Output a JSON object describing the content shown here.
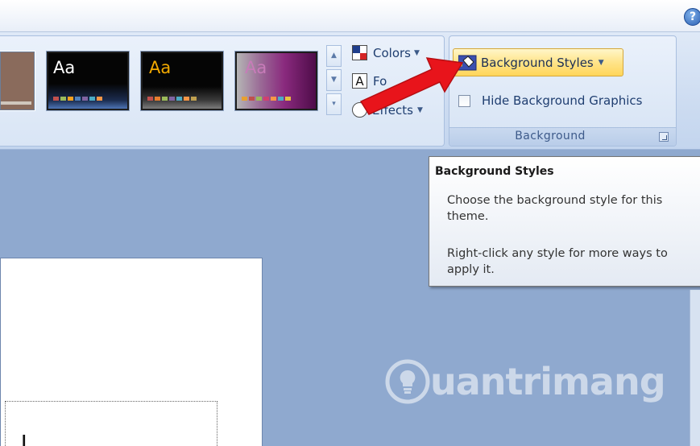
{
  "help": {
    "glyph": "?"
  },
  "themes": [
    {
      "aa": "",
      "aa_color": "#ffffff",
      "swatches": []
    },
    {
      "aa": "Aa",
      "aa_color": "#ffffff",
      "swatches": [
        "#c0504d",
        "#9bbb59",
        "#f4a020",
        "#4f81bd",
        "#8064a2",
        "#4bacc6",
        "#f79646"
      ]
    },
    {
      "aa": "Aa",
      "aa_color": "#f2a900",
      "swatches": [
        "#c0504d",
        "#e87d2e",
        "#9bbb59",
        "#8064a2",
        "#4bacc6",
        "#f79646",
        "#c0a050"
      ]
    },
    {
      "aa": "Aa",
      "aa_color": "#c87bb9",
      "swatches": [
        "#e8a030",
        "#c0504d",
        "#9bbb59",
        "#d04070",
        "#f79646",
        "#4bacc6",
        "#e8c040"
      ]
    }
  ],
  "theme_options": {
    "colors_label": "Colors",
    "fonts_label": "Fo",
    "effects_label": "Effects",
    "fonts_icon_glyph": "A"
  },
  "background_group": {
    "styles_button_label": "Background Styles",
    "hide_graphics_label": "Hide Background Graphics",
    "hide_graphics_checked": false,
    "group_label": "Background"
  },
  "tooltip": {
    "title": "Background Styles",
    "description": "Choose the background style for this theme.",
    "hint": "Right-click any style for more ways to apply it."
  },
  "watermark": {
    "text": "uantrimang"
  },
  "slide": {
    "placeholder_text": "ل"
  },
  "colors": {
    "arrow": "#e8141b",
    "accent_button": "#ffd65a"
  }
}
